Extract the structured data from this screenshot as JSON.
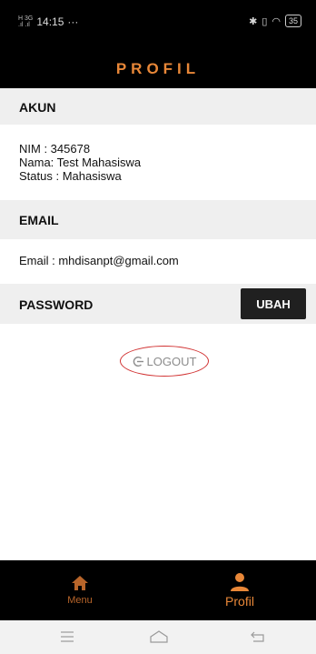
{
  "status_bar": {
    "signal": "H​+ 3G",
    "time": "14:15",
    "dots": "···",
    "battery": "35"
  },
  "header": {
    "title": "PROFIL"
  },
  "akun": {
    "label": "AKUN",
    "nim": "NIM : 345678",
    "nama": "Nama: Test Mahasiswa",
    "status": "Status : Mahasiswa"
  },
  "email": {
    "label": "EMAIL",
    "value": "Email : mhdisanpt@gmail.com"
  },
  "password": {
    "label": "PASSWORD",
    "ubah_label": "UBAH"
  },
  "logout": {
    "label": "LOGOUT"
  },
  "bottom_nav": {
    "items": [
      {
        "label": "Menu",
        "icon": "home-icon"
      },
      {
        "label": "Profil",
        "icon": "person-icon"
      }
    ]
  },
  "colors": {
    "accent": "#e88738",
    "dark": "#000000",
    "logout_outline": "#d13232"
  }
}
